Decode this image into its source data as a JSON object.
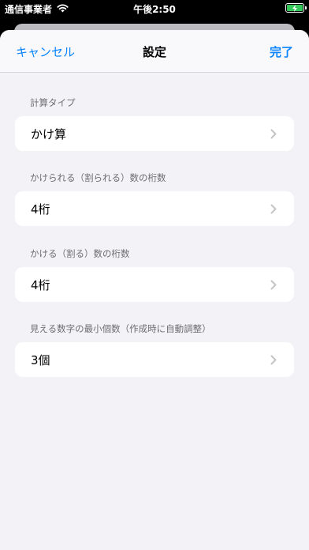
{
  "status_bar": {
    "carrier": "通信事業者",
    "time": "午後2:50",
    "wifi_icon": "wifi-icon",
    "battery_icon": "battery-charging-icon",
    "battery_color": "#34c759"
  },
  "nav": {
    "cancel_label": "キャンセル",
    "title": "設定",
    "done_label": "完了",
    "accent_color": "#0a84ff"
  },
  "settings": [
    {
      "header": "計算タイプ",
      "value": "かけ算"
    },
    {
      "header": "かけられる（割られる）数の桁数",
      "value": "4桁"
    },
    {
      "header": "かける（割る）数の桁数",
      "value": "4桁"
    },
    {
      "header": "見える数字の最小個数（作成時に自動調整）",
      "value": "3個"
    }
  ]
}
